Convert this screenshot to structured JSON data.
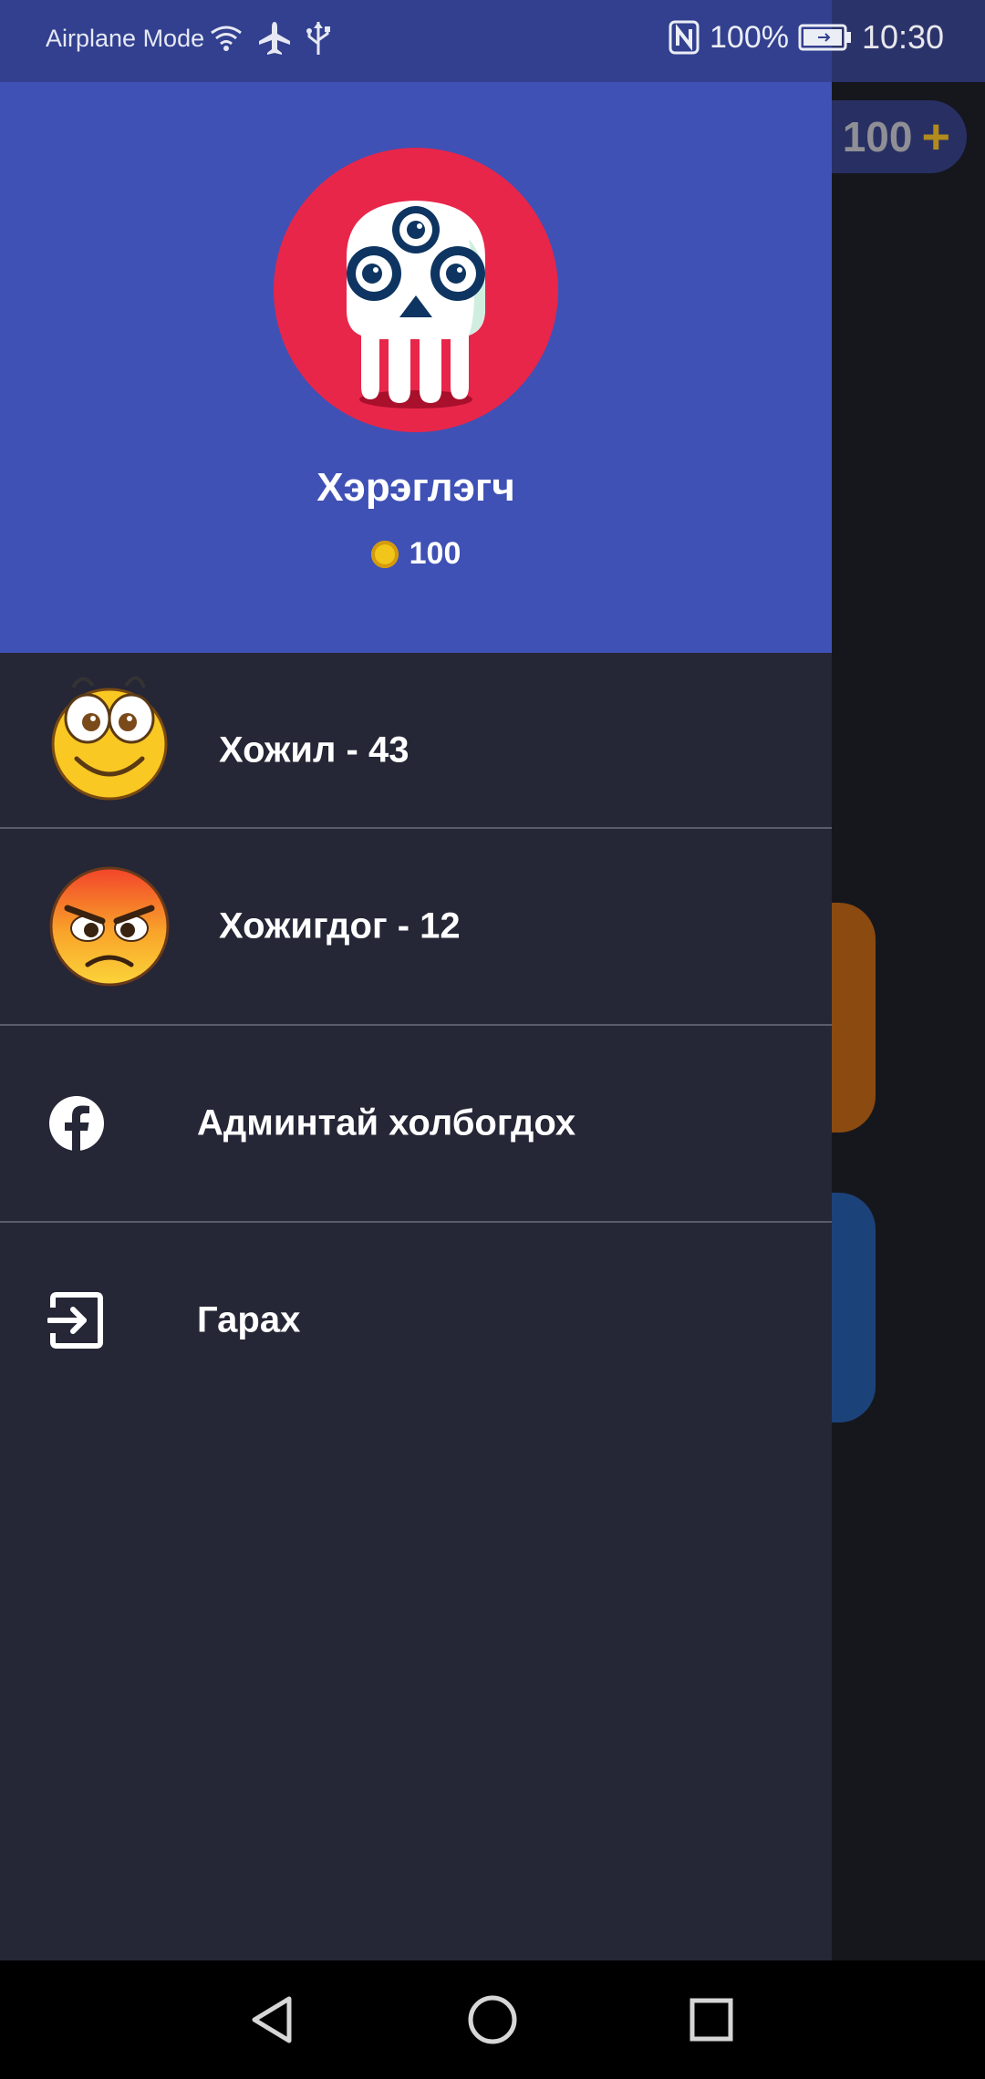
{
  "status_bar": {
    "left_text": "Airplane Mode",
    "battery": "100%",
    "time": "10:30",
    "icons": [
      "wifi-icon",
      "airplane-icon",
      "usb-icon",
      "nfc-icon",
      "battery-icon"
    ]
  },
  "background_app": {
    "coin_balance": "100",
    "coin_plus": "+"
  },
  "drawer": {
    "header": {
      "avatar": "skull-avatar-icon",
      "username": "Хэрэглэгч",
      "coins": "100"
    },
    "items": [
      {
        "label": "Хожил - 43",
        "icon": "happy-emoji-icon"
      },
      {
        "label": "Хожигдог - 12",
        "icon": "angry-emoji-icon"
      },
      {
        "label": "Админтай холбогдох",
        "icon": "facebook-icon"
      },
      {
        "label": "Гарах",
        "icon": "logout-icon"
      }
    ]
  },
  "nav_bar": {
    "icons": [
      "back-icon",
      "home-icon",
      "recents-icon"
    ]
  },
  "colors": {
    "header_blue": "#3f51b5",
    "drawer_bg": "#252636",
    "avatar_red": "#e8264a",
    "coin_gold": "#f2c51a"
  }
}
